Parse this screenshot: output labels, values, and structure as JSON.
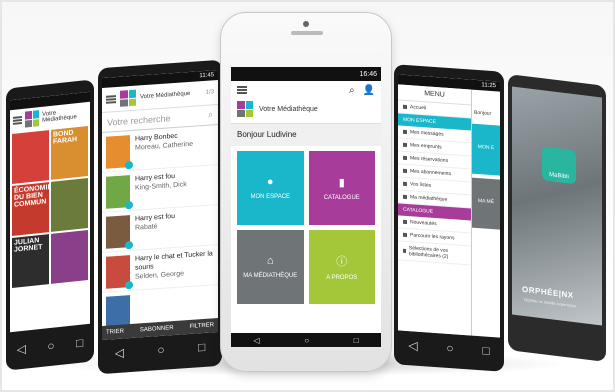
{
  "colors": {
    "purple": "#a73c9a",
    "teal": "#19b7c9",
    "gray": "#6f7477",
    "lime": "#a4c639",
    "dark": "#1a1a1a"
  },
  "phone_left_far": {
    "status_time": "",
    "header_title": "Votre Médiathèque",
    "covers": [
      {
        "text": "",
        "color": "#d5403b"
      },
      {
        "text": "BOND FARAH",
        "color": "#d98e2f"
      },
      {
        "text": "ÉCONOMIE DU BIEN COMMUN",
        "color": "#c43b2e"
      },
      {
        "text": "",
        "color": "#6a7b3c"
      },
      {
        "text": "JULIAN JORNET",
        "color": "#2d2d2d"
      },
      {
        "text": "",
        "color": "#8a3f8a"
      }
    ]
  },
  "phone_left": {
    "status_time": "11:45",
    "header_title": "Votre Médiathèque",
    "pager": "1/3",
    "search_placeholder": "Votre recherche",
    "results": [
      {
        "title": "Harry Bonbec",
        "author": "Moreau, Catherine",
        "color": "#e58d2f"
      },
      {
        "title": "Harry est fou",
        "author": "King-Smith, Dick",
        "color": "#6fa844"
      },
      {
        "title": "Harry est fou",
        "author": "Rabaté",
        "color": "#7a5b3f"
      },
      {
        "title": "Harry le chat et Tucker la souris",
        "author": "Selden, George",
        "color": "#c94b3e"
      },
      {
        "title": "",
        "author": "",
        "color": "#3d6ea8"
      }
    ],
    "tabs": [
      "TRIER",
      "SABONNER",
      "FILTRER"
    ]
  },
  "phone_main": {
    "status_time": "16:46",
    "header_title": "Votre Médiathèque",
    "search_icon": "search-icon",
    "user_icon": "user-icon",
    "greeting": "Bonjour Ludivine",
    "tiles": [
      {
        "label": "MON ESPACE",
        "icon": "person-icon",
        "color": "#19b7c9"
      },
      {
        "label": "CATALOGUE",
        "icon": "book-icon",
        "color": "#a73c9a"
      },
      {
        "label": "MA MÉDIATHÈQUE",
        "icon": "building-icon",
        "color": "#6f7477"
      },
      {
        "label": "A PROPOS",
        "icon": "info-icon",
        "color": "#a4c639"
      }
    ]
  },
  "phone_menu": {
    "status_time": "11:25",
    "menu_title": "MENU",
    "greeting_peek": "Bonjour",
    "peek_tile": "MON E",
    "peek_tile2": "MA MÉ",
    "rows": [
      {
        "label": "Accueil",
        "type": "item"
      },
      {
        "label": "MON ESPACE",
        "type": "section",
        "color": "#19b7c9"
      },
      {
        "label": "Mes messages",
        "type": "item"
      },
      {
        "label": "Mes emprunts",
        "type": "item"
      },
      {
        "label": "Mes réservations",
        "type": "item"
      },
      {
        "label": "Mes abonnements",
        "type": "item"
      },
      {
        "label": "Vos listes",
        "type": "item"
      },
      {
        "label": "Ma médiathèque",
        "type": "item"
      },
      {
        "label": "CATALOGUE",
        "type": "section",
        "color": "#a73c9a"
      },
      {
        "label": "Nouveautés",
        "type": "item"
      },
      {
        "label": "Parcourir les rayons",
        "type": "item"
      },
      {
        "label": "Sélections de vos bibliothécaires (2)",
        "type": "item"
      }
    ]
  },
  "phone_splash": {
    "app_name": "MaBibli",
    "brand": "ORPHÉE|NX",
    "tagline": "Orphée nx mobile experience"
  }
}
